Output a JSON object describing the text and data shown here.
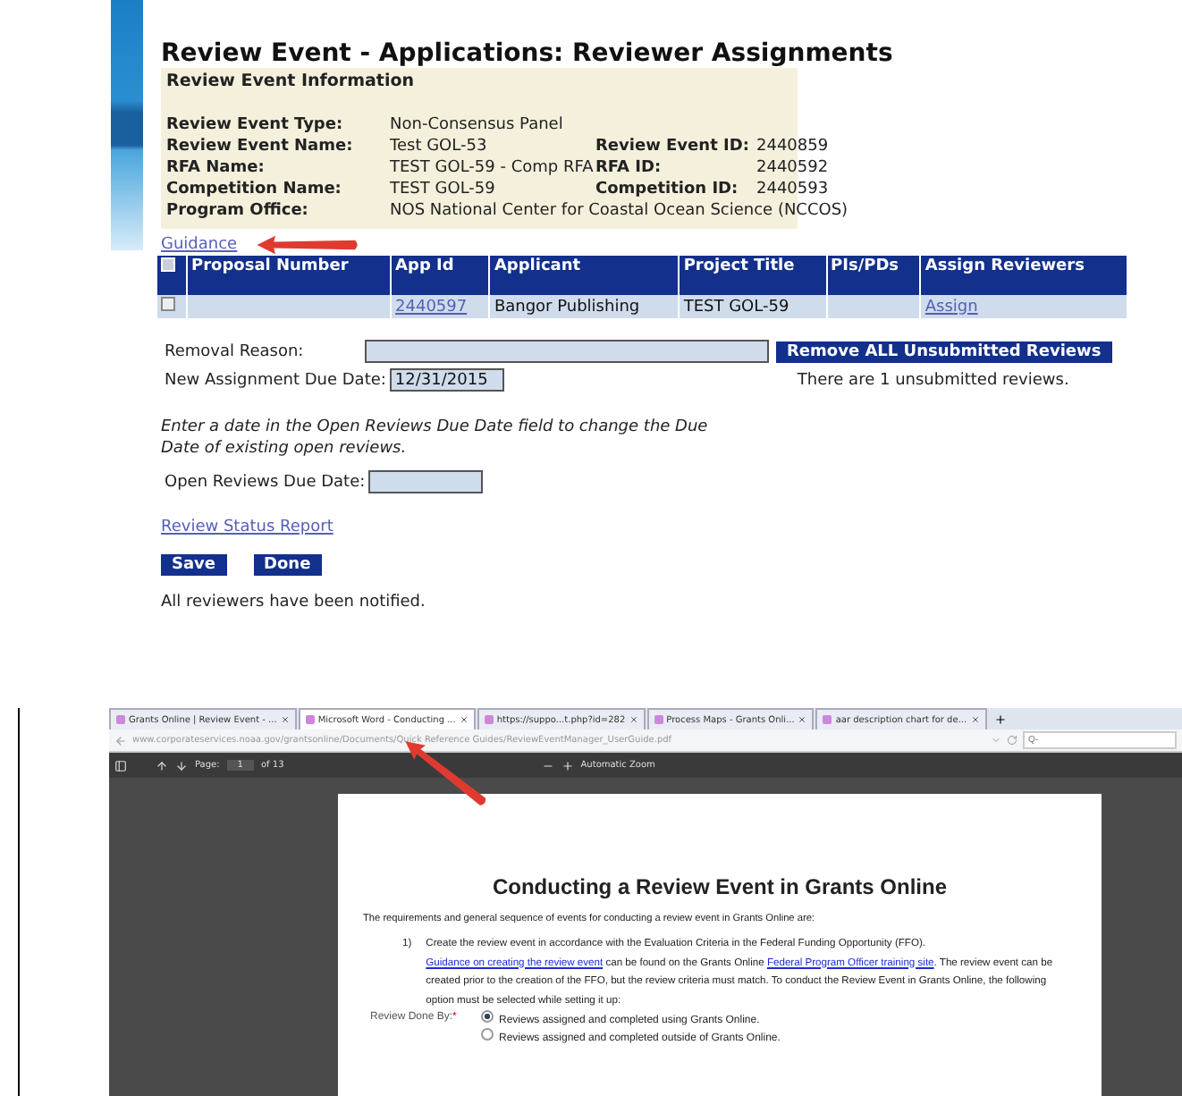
{
  "review_page": {
    "title": "Review Event - Applications: Reviewer Assignments",
    "info_heading": "Review Event Information",
    "info_rows": [
      {
        "label": "Review Event Type:",
        "value": "Non-Consensus Panel"
      },
      {
        "label": "Review Event Name:",
        "value": "Test GOL-53",
        "label_2": "Review Event ID:",
        "value_2": "2440859"
      },
      {
        "label": "RFA Name:",
        "value": "TEST GOL-59 - Comp RFA",
        "label_2": "RFA ID:",
        "value_2": "2440592"
      },
      {
        "label": "Competition Name:",
        "value": "TEST GOL-59",
        "label_2": "Competition ID:",
        "value_2": "2440593"
      },
      {
        "label": "Program Office:",
        "value": "NOS National Center for Coastal Ocean Science (NCCOS)"
      }
    ],
    "guidance_link": "Guidance",
    "table": {
      "columns": [
        "Proposal Number",
        "App Id",
        "Applicant",
        "Project Title",
        "PIs/PDs",
        "Assign Reviewers"
      ],
      "rows": [
        {
          "proposal_number": "",
          "app_id": "2440597",
          "applicant": "Bangor Publishing",
          "project_title": "TEST GOL-59",
          "pis_pds": "",
          "assign": "Assign"
        }
      ]
    },
    "removal_reason": {
      "label": "Removal Reason:"
    },
    "remove_button": "Remove ALL Unsubmitted Reviews",
    "new_due_date": {
      "label": "New Assignment Due Date:",
      "value": "12/31/2015"
    },
    "unsubmitted_note": "There are 1 unsubmitted reviews.",
    "instructions": "Enter a date in the Open Reviews Due Date field to change the Due Date of existing open reviews.",
    "open_due_date": {
      "label": "Open Reviews Due Date:"
    },
    "status_report_link": "Review Status Report",
    "buttons": [
      "Save",
      "Done"
    ],
    "message": "All reviewers have been notified."
  },
  "browser": {
    "tabs": [
      {
        "label": "Grants Online | Review Event - ...",
        "selected": false
      },
      {
        "label": "Microsoft Word - Conducting ...",
        "selected": true
      },
      {
        "label": "https://suppo...t.php?id=282",
        "selected": false
      },
      {
        "label": "Process Maps - Grants Onli...",
        "selected": false
      },
      {
        "label": "aar description chart for de...",
        "selected": false
      }
    ],
    "url": "www.corporateservices.noaa.gov/grantsonline/Documents/Quick Reference Guides/ReviewEventManager_UserGuide.pdf",
    "search_placeholder": "Q-",
    "pdf_toolbar": {
      "page_label": "Page:",
      "page": "1",
      "page_count": "of 13",
      "zoom": "Automatic Zoom"
    },
    "document": {
      "title": "Conducting a Review Event in Grants Online",
      "intro": "The requirements and general sequence of events for conducting a review event in Grants Online are:",
      "item_number": "1)",
      "item_segments": [
        {
          "text": "Create the review event in accordance with the Evaluation Criteria in the Federal Funding Opportunity (FFO).  ",
          "link": false
        },
        {
          "text": "Guidance on creating the review event",
          "link": true
        },
        {
          "text": " can be found on the Grants Online ",
          "link": false
        },
        {
          "text": "Federal Program Officer training site",
          "link": true
        },
        {
          "text": ".  The review event can be created prior to the creation of the FFO, but the review criteria must match.  To conduct the Review Event in Grants Online, the following option must be selected while setting it up:",
          "link": false
        }
      ],
      "field_label": "Review Done By:",
      "required_mark": "*",
      "options": [
        {
          "label": "Reviews assigned and completed using Grants Online.",
          "selected": true
        },
        {
          "label": "Reviews assigned and completed outside of Grants Online.",
          "selected": false
        }
      ]
    }
  }
}
